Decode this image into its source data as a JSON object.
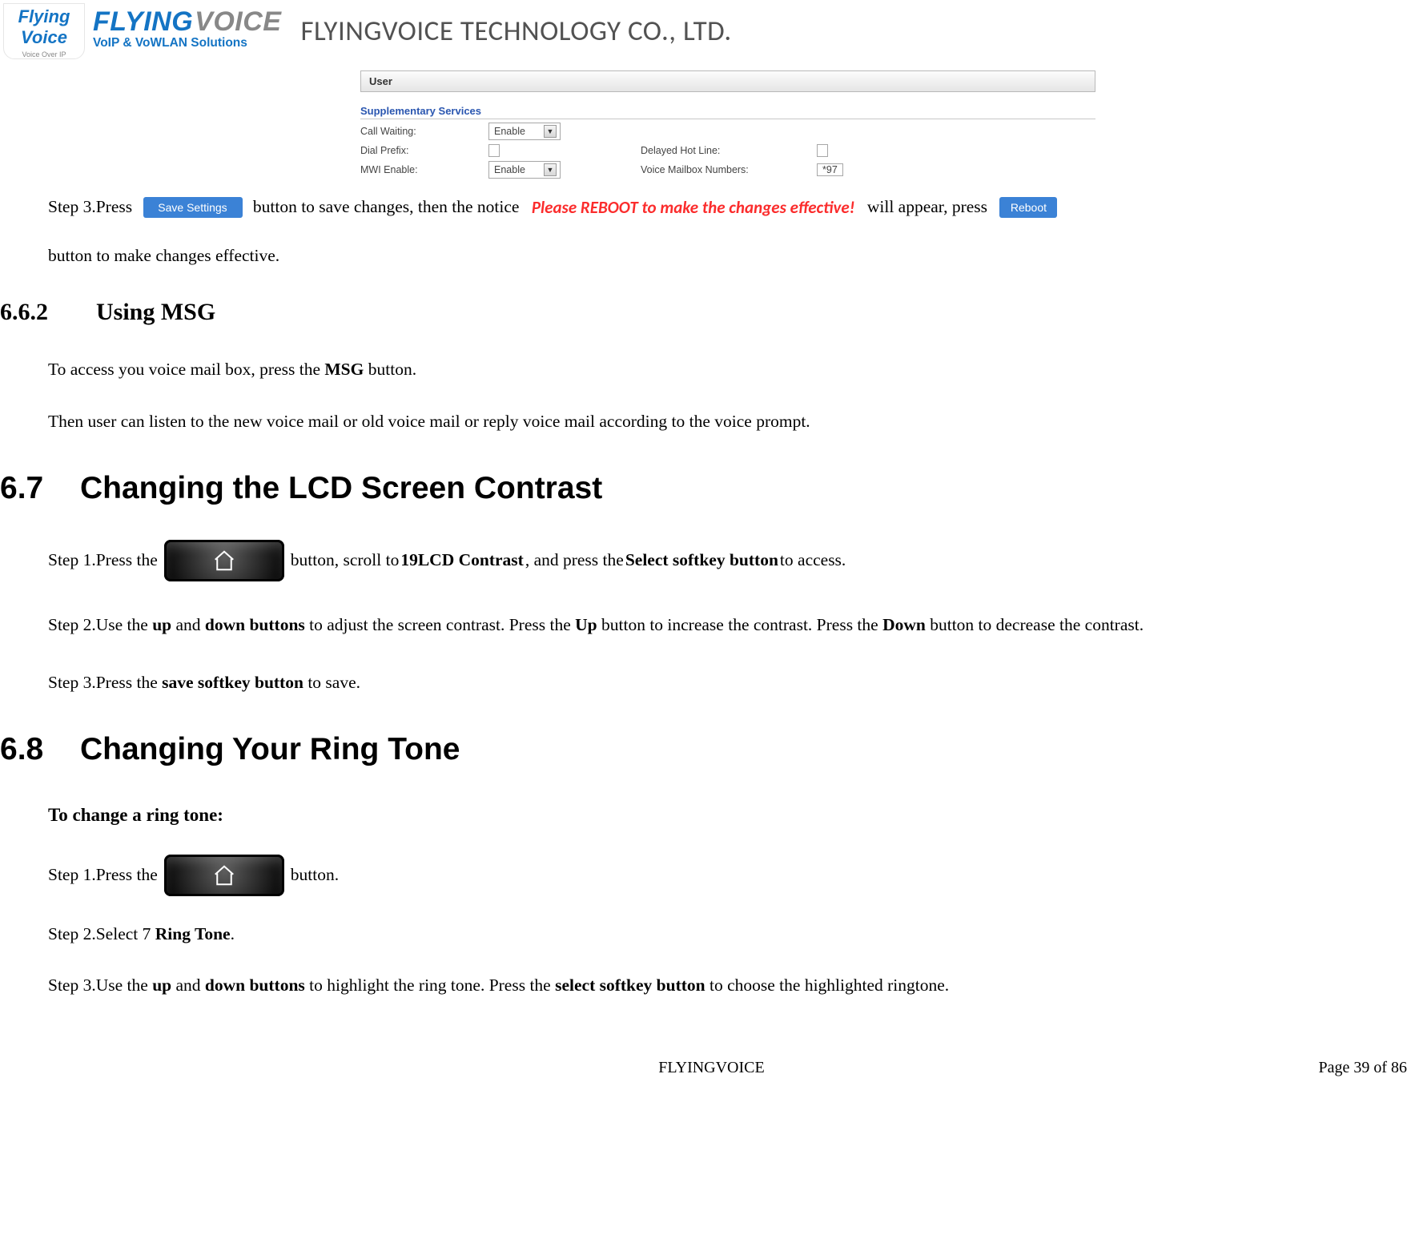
{
  "header": {
    "logo_small_line1": "Flying",
    "logo_small_line2": "Voice",
    "logo_small_sub": "Voice Over IP",
    "brand_flying": "FLYING",
    "brand_voice": "VOICE",
    "brand_sub": "VoIP & VoWLAN Solutions",
    "company": "FLYINGVOICE TECHNOLOGY CO., LTD."
  },
  "ui": {
    "tab": "User",
    "section": "Supplementary Services",
    "rows": {
      "call_waiting_label": "Call Waiting:",
      "call_waiting_value": "Enable",
      "dial_prefix_label": "Dial Prefix:",
      "dial_prefix_value": "",
      "delayed_hotline_label": "Delayed Hot Line:",
      "delayed_hotline_value": "",
      "mwi_enable_label": "MWI Enable:",
      "mwi_enable_value": "Enable",
      "voice_mailbox_label": "Voice Mailbox Numbers:",
      "voice_mailbox_value": "*97"
    }
  },
  "step3_line": {
    "a": "Step 3.Press ",
    "save_label": "Save Settings",
    "b": " button to save changes, then the notice ",
    "notice": "Please REBOOT to make the changes effective!",
    "c": " will appear, press ",
    "reboot_label": "Reboot",
    "d": "button to make changes effective."
  },
  "s662": {
    "num": "6.6.2",
    "title": "Using MSG",
    "p1a": "To access you voice mail box, press the ",
    "p1b": "MSG",
    "p1c": " button.",
    "p2": "Then user can listen to the new voice mail or old voice mail or reply voice mail according to the voice prompt."
  },
  "s67": {
    "num": "6.7",
    "title": "Changing the LCD Screen Contrast",
    "step1a": "Step 1.Press the ",
    "step1b": " button, scroll to ",
    "step1c": "19LCD Contrast",
    "step1d": ", and press the ",
    "step1e": "Select softkey button",
    "step1f": " to access.",
    "step2a": "Step 2.Use the ",
    "step2b": "up",
    "step2c": " and ",
    "step2d": "down buttons",
    "step2e": " to adjust the screen contrast. Press the ",
    "step2f": "Up",
    "step2g": " button to increase the contrast. Press the ",
    "step2h": "Down",
    "step2i": " button to decrease the contrast.",
    "step3a": "Step 3.Press the ",
    "step3b": "save softkey button",
    "step3c": " to save."
  },
  "s68": {
    "num": "6.8",
    "title": "Changing Your Ring Tone",
    "sub": "To change a ring tone:",
    "step1a": "Step 1.Press the ",
    "step1b": " button.",
    "step2a": "Step 2.Select 7 ",
    "step2b": "Ring Tone",
    "step2c": ".",
    "step3a": "Step 3.Use the ",
    "step3b": "up",
    "step3c": " and ",
    "step3d": "down buttons",
    "step3e": " to highlight the ring tone. Press the ",
    "step3f": "select softkey button",
    "step3g": " to choose the highlighted ringtone."
  },
  "footer": {
    "center": "FLYINGVOICE",
    "right": "Page  39  of  86"
  }
}
